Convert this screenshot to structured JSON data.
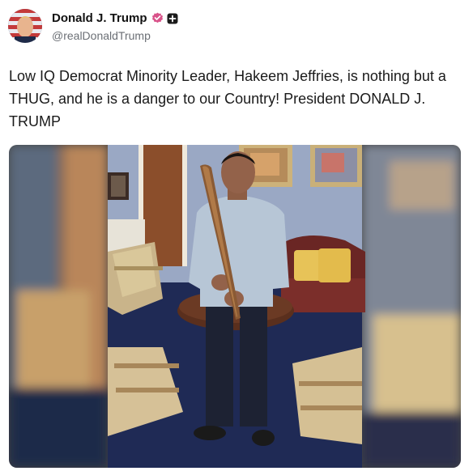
{
  "post": {
    "author_name": "Donald J. Trump",
    "author_handle": "@realDonaldTrump",
    "text": "Low IQ Democrat Minority Leader, Hakeem Jeffries, is nothing but a THUG, and he is a danger to our Country! President DONALD J. TRUMP"
  },
  "icons": {
    "verified": "verified-badge-icon",
    "plus": "plus-badge-icon"
  },
  "colors": {
    "verified_badge": "#d9538a",
    "handle_text": "#6b6f75"
  }
}
